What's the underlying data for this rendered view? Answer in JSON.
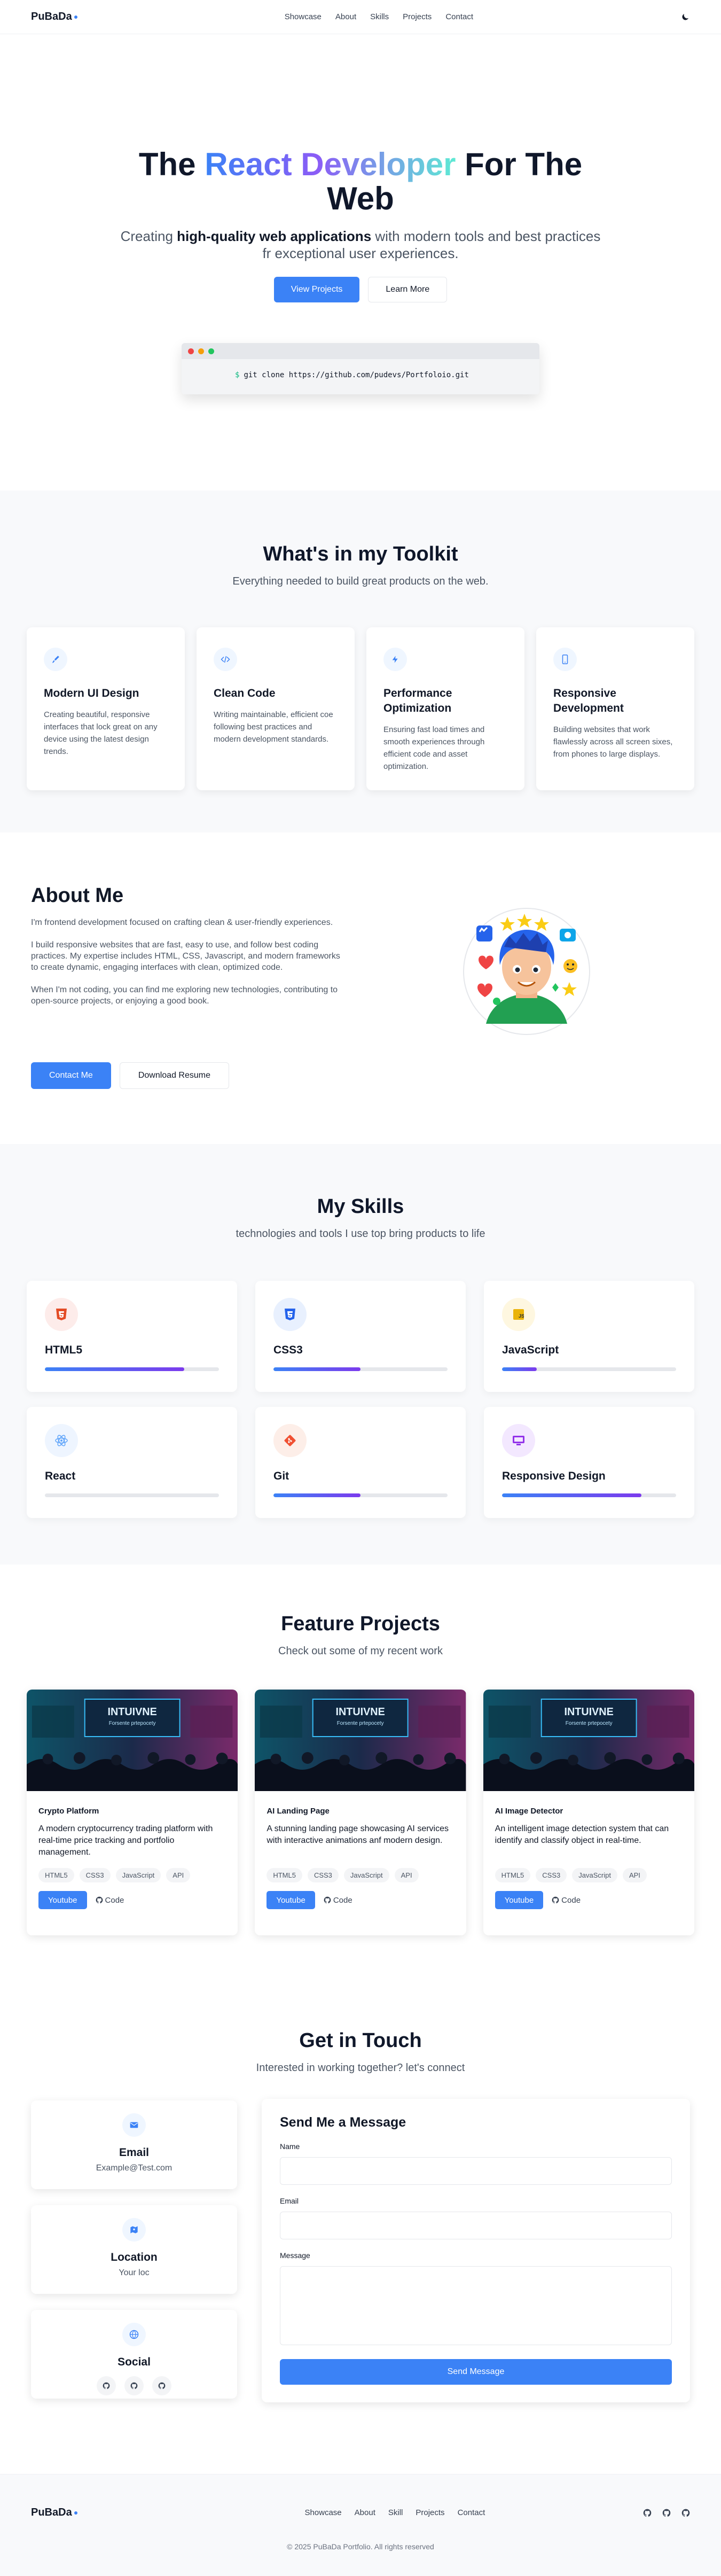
{
  "header": {
    "logo": "PuBaDa",
    "nav": [
      "Showcase",
      "About",
      "Skills",
      "Projects",
      "Contact"
    ],
    "theme_icon": "moon-icon"
  },
  "hero": {
    "title_pre": "The ",
    "title_grad": "React Developer",
    "title_post": " For The Web",
    "sub_pre": "Creating ",
    "sub_bold": "high-quality web applications",
    "sub_post": " with modern tools and best practices fr exceptional user experiences.",
    "btn_primary": "View Projects",
    "btn_secondary": "Learn More",
    "terminal_prompt": "$",
    "terminal_cmd": "git clone https://github.com/pudevs/Portfoloio.git"
  },
  "toolkit": {
    "title": "What's in my Toolkit",
    "subtitle": "Everything needed to build great products on the web.",
    "cards": [
      {
        "icon": "brush-icon",
        "title": "Modern UI Design",
        "text": "Creating beautiful, responsive interfaces that lock great on any device using the latest design trends."
      },
      {
        "icon": "code-icon",
        "title": "Clean Code",
        "text": "Writing maintainable, efficient coe following best practices and modern development standards."
      },
      {
        "icon": "bolt-icon",
        "title": "Performance Optimization",
        "text": "Ensuring fast load times and smooth experiences through efficient code and asset optimization."
      },
      {
        "icon": "phone-icon",
        "title": "Responsive Development",
        "text": "Building websites that work flawlessly across all screen sixes, from phones to large displays."
      }
    ]
  },
  "about": {
    "title": "About Me",
    "p1": "I'm frontend development focused on crafting clean & user-friendly experiences.",
    "p2": "I build responsive websites that are fast, easy to use, and follow best coding practices. My expertise includes HTML, CSS, Javascript, and modern frameworks to create dynamic, engaging interfaces with clean, optimized code.",
    "p3": "When I'm not coding, you can find me exploring new technologies, contributing to open-source projects, or enjoying a good book.",
    "btn_contact": "Contact Me",
    "btn_resume": "Download Resume"
  },
  "skills": {
    "title": "My Skills",
    "subtitle": "technologies and tools I use top bring products to life",
    "items": [
      {
        "name": "HTML5",
        "level": 0.8,
        "icon": "html5-icon",
        "color": "#e34c26",
        "bg": "#fdecea"
      },
      {
        "name": "CSS3",
        "level": 0.5,
        "icon": "css3-icon",
        "color": "#2563eb",
        "bg": "#e8f0fe"
      },
      {
        "name": "JavaScript",
        "level": 0.2,
        "icon": "javascript-icon",
        "color": "#eab308",
        "bg": "#fef7e0"
      },
      {
        "name": "React",
        "level": 0.0,
        "icon": "react-icon",
        "color": "#60a5fa",
        "bg": "#eef5ff"
      },
      {
        "name": "Git",
        "level": 0.5,
        "icon": "git-icon",
        "color": "#f05032",
        "bg": "#fdeee8"
      },
      {
        "name": "Responsive Design",
        "level": 0.8,
        "icon": "monitor-icon",
        "color": "#9333ea",
        "bg": "#f3e8ff"
      }
    ]
  },
  "projects": {
    "title": "Feature Projects",
    "subtitle": "Check out some of my recent work",
    "image_text": "INTUIVNE",
    "image_sub": "Forsente prtepocety",
    "items": [
      {
        "title": "Crypto Platform",
        "desc": "A modern cryptocurrency trading platform with real-time price tracking and portfolio management.",
        "tags": [
          "HTML5",
          "CSS3",
          "JavaScript",
          "API"
        ],
        "btn": "Youtube",
        "code": "Code"
      },
      {
        "title": "AI Landing Page",
        "desc": "A stunning landing page showcasing AI services with interactive animations anf modern design.",
        "tags": [
          "HTML5",
          "CSS3",
          "JavaScript",
          "API"
        ],
        "btn": "Youtube",
        "code": "Code"
      },
      {
        "title": "AI Image Detector",
        "desc": "An intelligent image detection system that can identify and classify object in real-time.",
        "tags": [
          "HTML5",
          "CSS3",
          "JavaScript",
          "API"
        ],
        "btn": "Youtube",
        "code": "Code"
      }
    ]
  },
  "contact": {
    "title": "Get in Touch",
    "subtitle": "Interested in working together? let's connect",
    "email_label": "Email",
    "email_value": "Example@Test.com",
    "location_label": "Location",
    "location_value": "Your loc",
    "social_label": "Social",
    "form_title": "Send Me a Message",
    "name_label": "Name",
    "email_field_label": "Email",
    "message_label": "Message",
    "send_btn": "Send Message"
  },
  "footer": {
    "logo": "PuBaDa",
    "nav": [
      "Showcase",
      "About",
      "Skill",
      "Projects",
      "Contact"
    ],
    "copyright": "© 2025 PuBaDa Portfolio. All rights reserved"
  }
}
